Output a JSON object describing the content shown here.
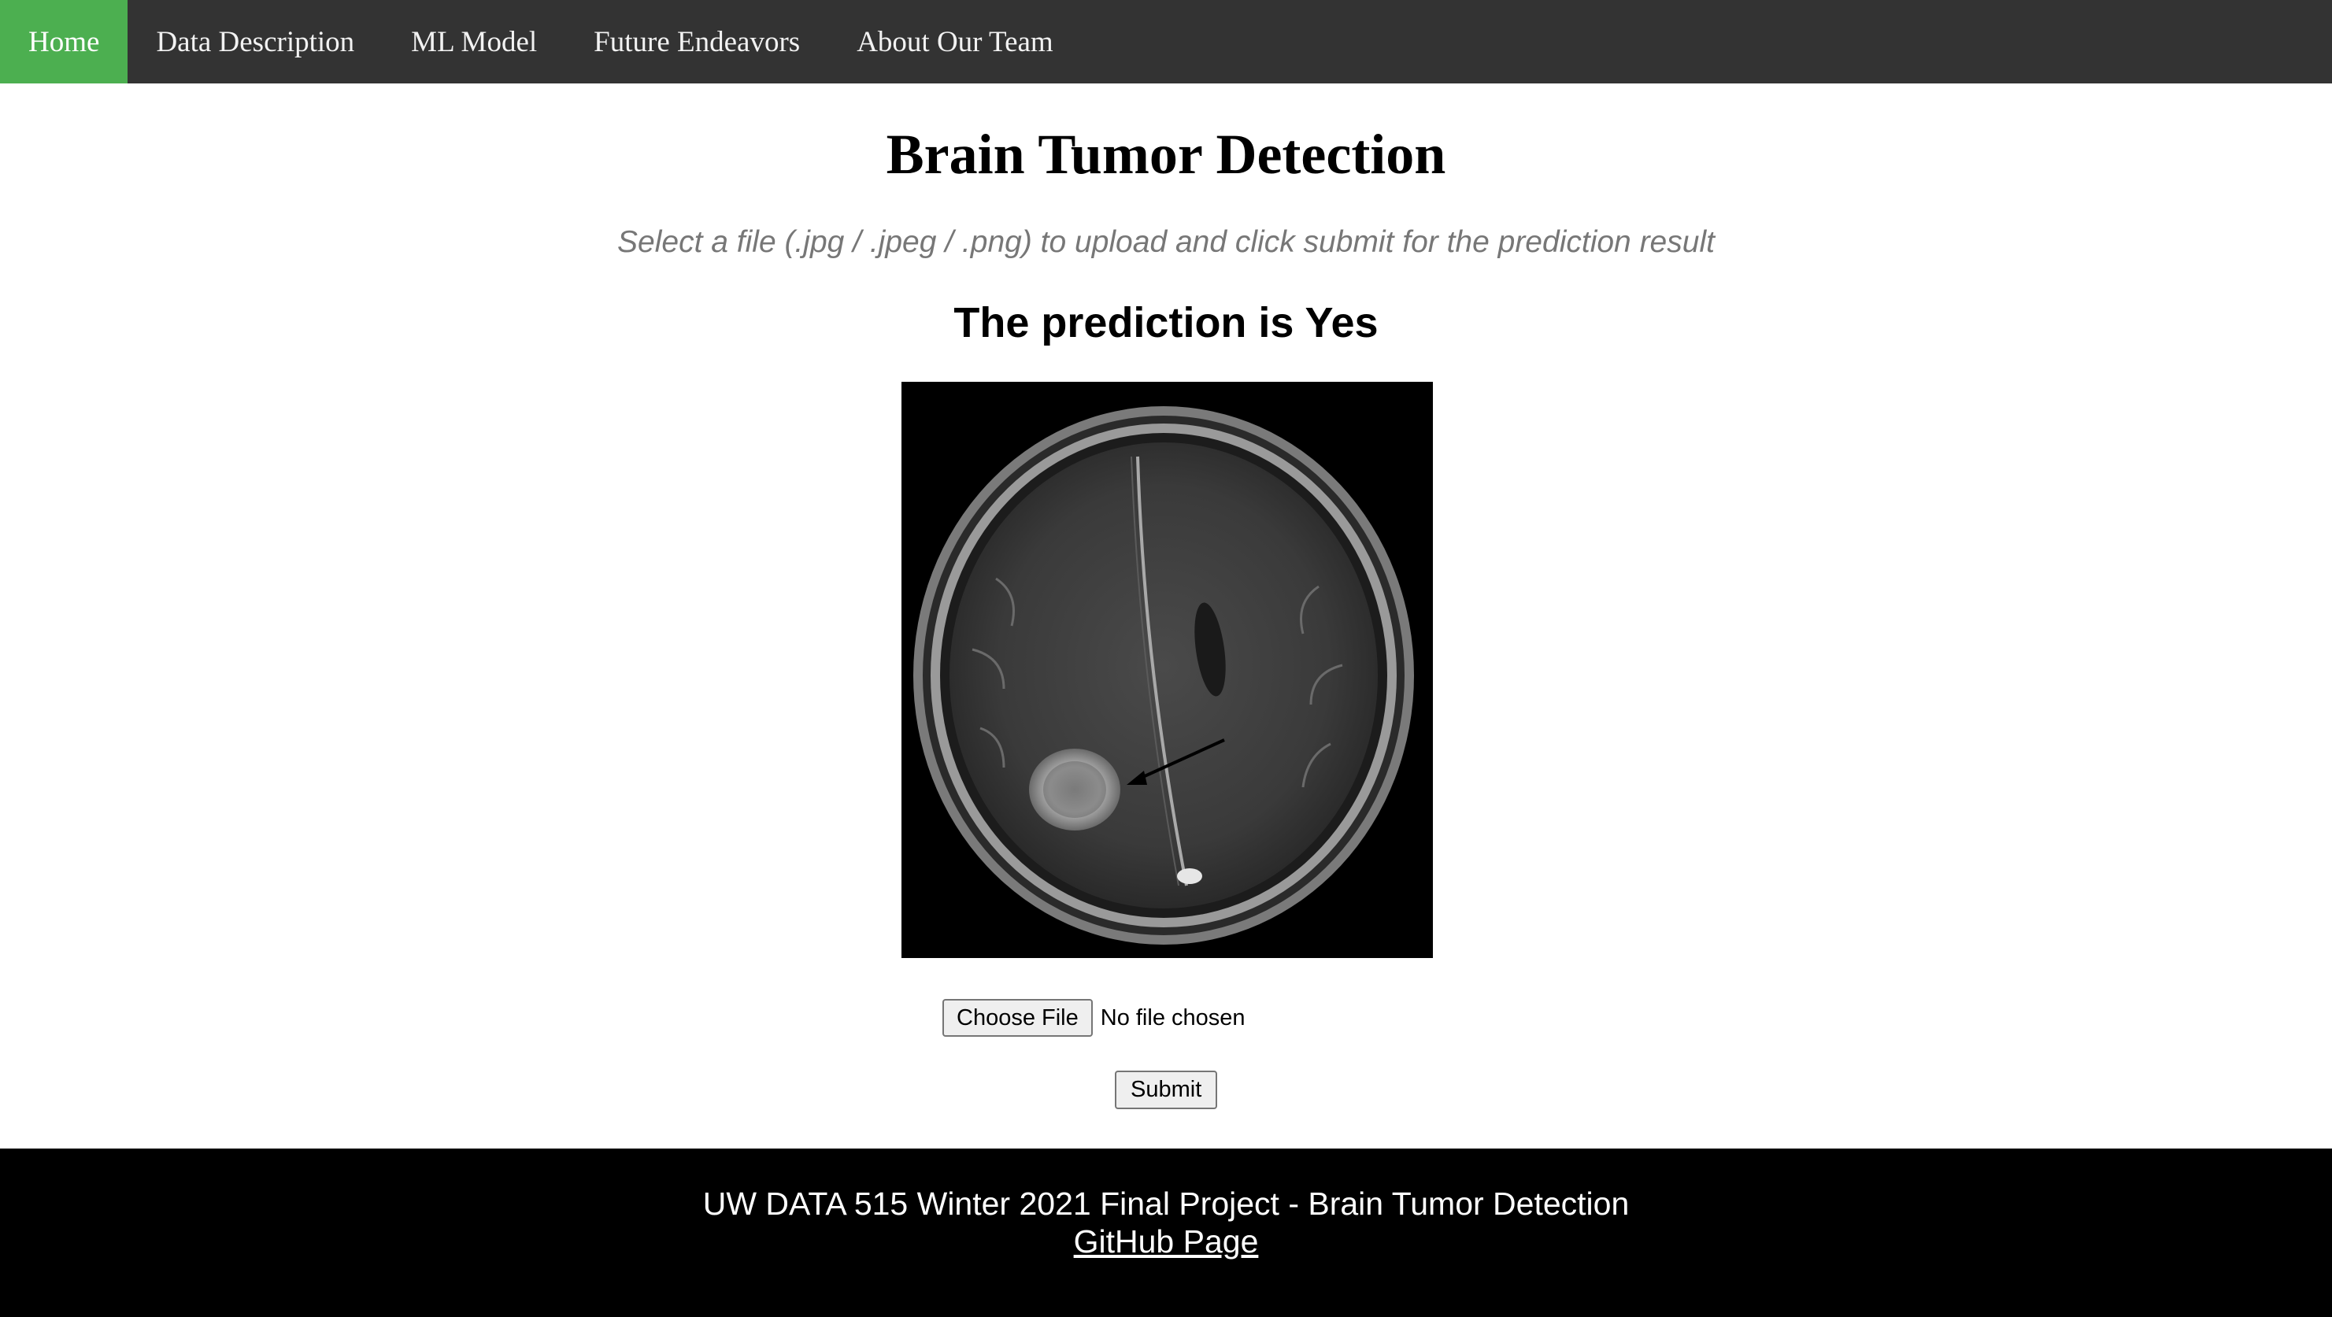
{
  "nav": {
    "items": [
      {
        "label": "Home",
        "active": true
      },
      {
        "label": "Data Description",
        "active": false
      },
      {
        "label": "ML Model",
        "active": false
      },
      {
        "label": "Future Endeavors",
        "active": false
      },
      {
        "label": "About Our Team",
        "active": false
      }
    ],
    "active_color": "#4CAF50",
    "bar_color": "#333333"
  },
  "main": {
    "title": "Brain Tumor Detection",
    "subtitle": "Select a file (.jpg / .jpeg / .png) to upload and click submit for the prediction result",
    "prediction": "The prediction is Yes",
    "image": {
      "kind": "brain-mri-scan",
      "highlight": "tumor-with-arrow"
    },
    "file_input": {
      "button_label": "Choose File",
      "status": "No file chosen"
    },
    "submit_label": "Submit"
  },
  "footer": {
    "text": "UW DATA 515 Winter 2021 Final Project - Brain Tumor Detection",
    "link_label": "GitHub Page"
  }
}
